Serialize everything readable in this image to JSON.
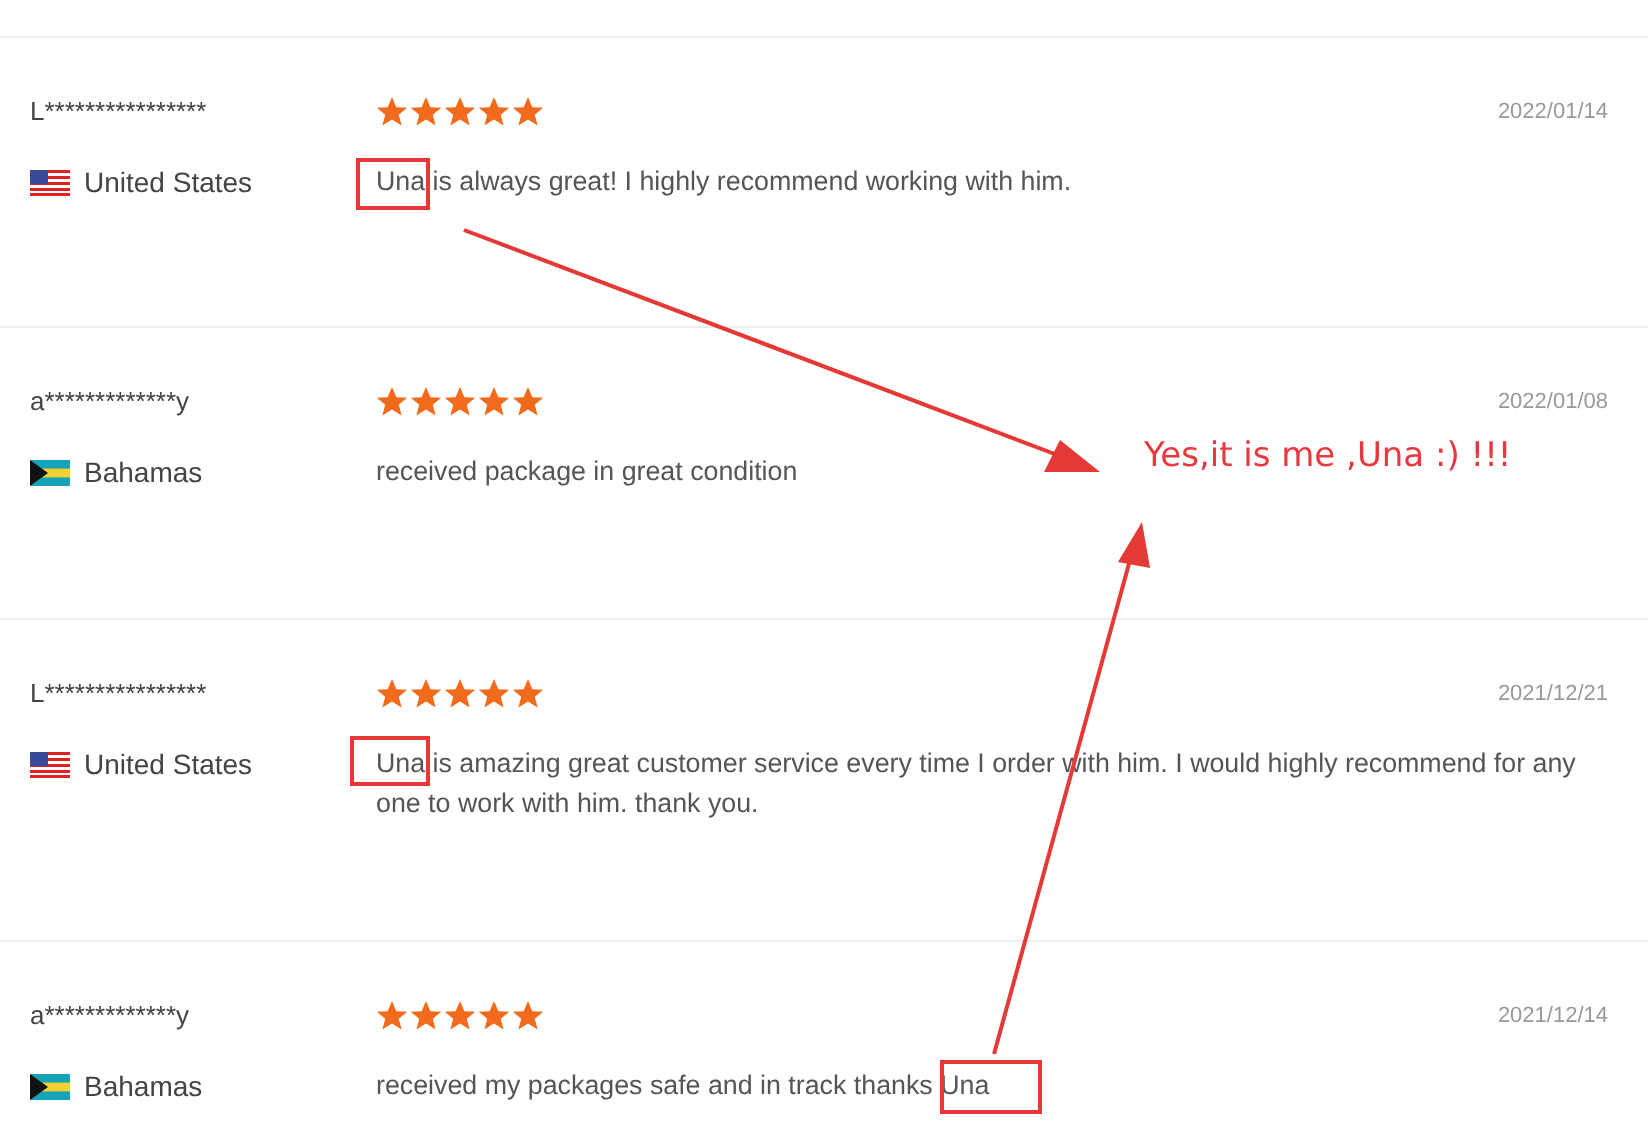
{
  "reviews": [
    {
      "name": "L****************",
      "country": "United States",
      "kind": "us",
      "stars": 5,
      "date": "2022/01/14",
      "text": "Una is always great! I highly recommend working with him.",
      "highlighted": true
    },
    {
      "name": "a*************y",
      "country": "Bahamas",
      "kind": "bs",
      "stars": 5,
      "date": "2022/01/08",
      "text": "received package in great condition",
      "highlighted": false
    },
    {
      "name": "L****************",
      "country": "United States",
      "kind": "us",
      "stars": 5,
      "date": "2021/12/21",
      "text": "Una is amazing great customer service every time I order with him. I would highly recommend for any one to work with him. thank you.",
      "highlighted": true
    },
    {
      "name": "a*************y",
      "country": "Bahamas",
      "kind": "bs",
      "stars": 5,
      "date": "2021/12/14",
      "text": "received my packages safe and in track thanks Una",
      "highlighted": true
    }
  ],
  "annotation": {
    "callout": "Yes,it is me ,Una :) !!!"
  }
}
